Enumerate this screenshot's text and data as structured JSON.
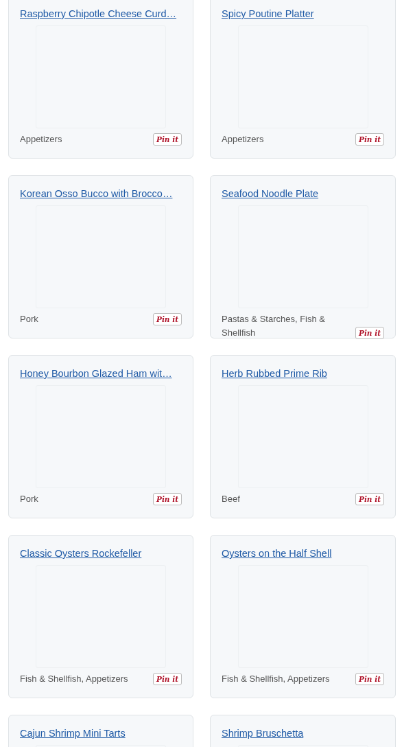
{
  "cards": [
    {
      "title": "Raspberry Chipotle Cheese Curd…",
      "category": "Appetizers",
      "pin_label": "Pin it"
    },
    {
      "title": "Spicy Poutine Platter",
      "category": "Appetizers",
      "pin_label": "Pin it"
    },
    {
      "title": "Korean Osso Bucco with Brocco…",
      "category": "Pork",
      "pin_label": "Pin it"
    },
    {
      "title": "Seafood Noodle Plate",
      "category": "Pastas & Starches, Fish & Shellfish",
      "pin_label": "Pin it"
    },
    {
      "title": "Honey Bourbon Glazed Ham wit…",
      "category": "Pork",
      "pin_label": "Pin it"
    },
    {
      "title": "Herb Rubbed Prime Rib",
      "category": "Beef",
      "pin_label": "Pin it"
    },
    {
      "title": "Classic Oysters Rockefeller",
      "category": "Fish & Shellfish, Appetizers",
      "pin_label": "Pin it"
    },
    {
      "title": "Oysters on the Half Shell",
      "category": "Fish & Shellfish, Appetizers",
      "pin_label": "Pin it"
    },
    {
      "title": "Cajun Shrimp Mini Tarts"
    },
    {
      "title": "Shrimp Bruschetta"
    }
  ]
}
